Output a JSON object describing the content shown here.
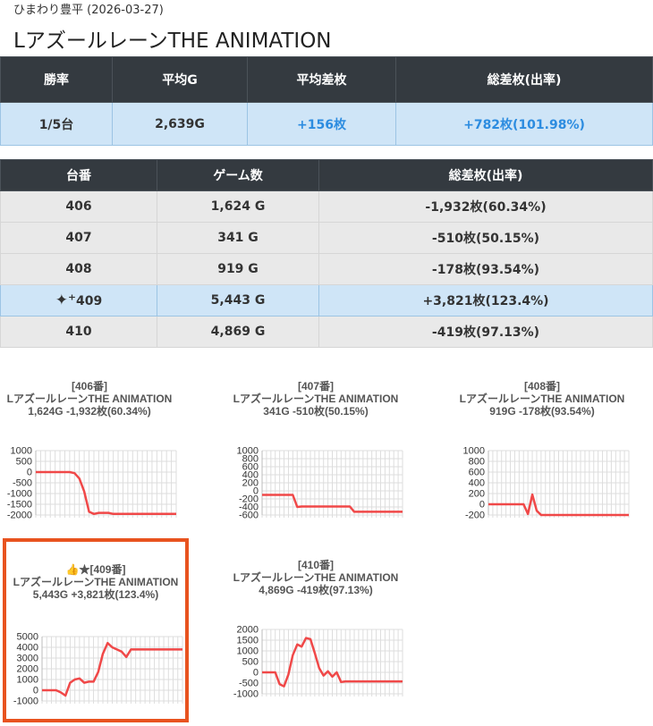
{
  "header": {
    "subtitle": "ひまわり豊平 (2026-03-27)",
    "title": "LアズールレーンTHE ANIMATION"
  },
  "summary": {
    "headers": [
      "勝率",
      "平均G",
      "平均差枚",
      "総差枚(出率)"
    ],
    "row": [
      "1/5台",
      "2,639G",
      "+156枚",
      "+782枚(101.98%)"
    ]
  },
  "machines": {
    "headers": [
      "台番",
      "ゲーム数",
      "総差枚(出率)"
    ],
    "rows": [
      {
        "num": "406",
        "games": "1,624 G",
        "diff": "-1,932枚(60.34%)"
      },
      {
        "num": "407",
        "games": "341 G",
        "diff": "-510枚(50.15%)"
      },
      {
        "num": "408",
        "games": "919 G",
        "diff": "-178枚(93.54%)"
      },
      {
        "num": "409",
        "games": "5,443 G",
        "diff": "+3,821枚(123.4%)",
        "icon": "sparkle-icon"
      },
      {
        "num": "410",
        "games": "4,869 G",
        "diff": "-419枚(97.13%)"
      }
    ]
  },
  "colors": {
    "line": "#f04848",
    "highlight_border": "#e8531f",
    "header_bg": "#343a40",
    "highlight_bg": "#cfe5f7",
    "positive": "#2c8ce0"
  },
  "charts": [
    {
      "line1": "[406番]",
      "line2": "LアズールレーンTHE ANIMATION",
      "line3": "1,624G -1,932枚(60.34%)"
    },
    {
      "line1": "[407番]",
      "line2": "LアズールレーンTHE ANIMATION",
      "line3": "341G -510枚(50.15%)"
    },
    {
      "line1": "[408番]",
      "line2": "LアズールレーンTHE ANIMATION",
      "line3": "919G -178枚(93.54%)"
    },
    {
      "line1": "👍★[409番]",
      "line2": "LアズールレーンTHE ANIMATION",
      "line3": "5,443G +3,821枚(123.4%)"
    },
    {
      "line1": "[410番]",
      "line2": "LアズールレーンTHE ANIMATION",
      "line3": "4,869G -419枚(97.13%)"
    }
  ],
  "chart_data": [
    {
      "type": "line",
      "ylim": [
        -2000,
        1000
      ],
      "yticks": [
        1000,
        500,
        0,
        -500,
        -1000,
        -1500,
        -2000
      ],
      "series": [
        {
          "values": [
            0,
            0,
            0,
            0,
            0,
            0,
            0,
            0,
            -50,
            -300,
            -900,
            -1850,
            -1950,
            -1900,
            -1900,
            -1900,
            -1950,
            -1950,
            -1950,
            -1950,
            -1950,
            -1950,
            -1950,
            -1950,
            -1950,
            -1950,
            -1950,
            -1950,
            -1950,
            -1950
          ]
        }
      ]
    },
    {
      "type": "line",
      "ylim": [
        -600,
        1000
      ],
      "yticks": [
        1000,
        800,
        600,
        400,
        200,
        0,
        -200,
        -400,
        -600
      ],
      "series": [
        {
          "values": [
            -100,
            -100,
            -100,
            -100,
            -100,
            -100,
            -100,
            -100,
            -400,
            -390,
            -390,
            -390,
            -390,
            -390,
            -390,
            -390,
            -390,
            -390,
            -390,
            -390,
            -390,
            -520,
            -520,
            -520,
            -520,
            -520,
            -520,
            -520,
            -520,
            -520,
            -520,
            -520,
            -520
          ]
        }
      ]
    },
    {
      "type": "line",
      "ylim": [
        -200,
        1000
      ],
      "yticks": [
        1000,
        800,
        600,
        400,
        200,
        0,
        -200
      ],
      "series": [
        {
          "values": [
            0,
            0,
            0,
            0,
            0,
            0,
            0,
            0,
            0,
            -180,
            180,
            -120,
            -200,
            -200,
            -200,
            -200,
            -200,
            -200,
            -200,
            -200,
            -200,
            -200,
            -200,
            -200,
            -200,
            -200,
            -200,
            -200,
            -200,
            -200,
            -200,
            -200,
            -200
          ]
        }
      ]
    },
    {
      "type": "line",
      "ylim": [
        -1000,
        5000
      ],
      "yticks": [
        5000,
        4000,
        3000,
        2000,
        1000,
        0,
        -1000
      ],
      "series": [
        {
          "values": [
            0,
            0,
            0,
            0,
            -200,
            -500,
            700,
            1000,
            1100,
            700,
            800,
            800,
            1700,
            3400,
            4400,
            4000,
            3800,
            3600,
            3100,
            3800,
            3800,
            3800,
            3800,
            3800,
            3800,
            3800,
            3800,
            3800,
            3800,
            3800,
            3800
          ]
        }
      ]
    },
    {
      "type": "line",
      "ylim": [
        -1000,
        2000
      ],
      "yticks": [
        2000,
        1500,
        1000,
        500,
        0,
        -500,
        -1000
      ],
      "series": [
        {
          "values": [
            0,
            0,
            0,
            0,
            -550,
            -650,
            -100,
            800,
            1300,
            1200,
            1600,
            1550,
            900,
            200,
            -150,
            50,
            -200,
            0,
            -450,
            -420,
            -420,
            -420,
            -420,
            -420,
            -420,
            -420,
            -420,
            -420,
            -420,
            -420,
            -420,
            -420,
            -420
          ]
        }
      ]
    }
  ]
}
